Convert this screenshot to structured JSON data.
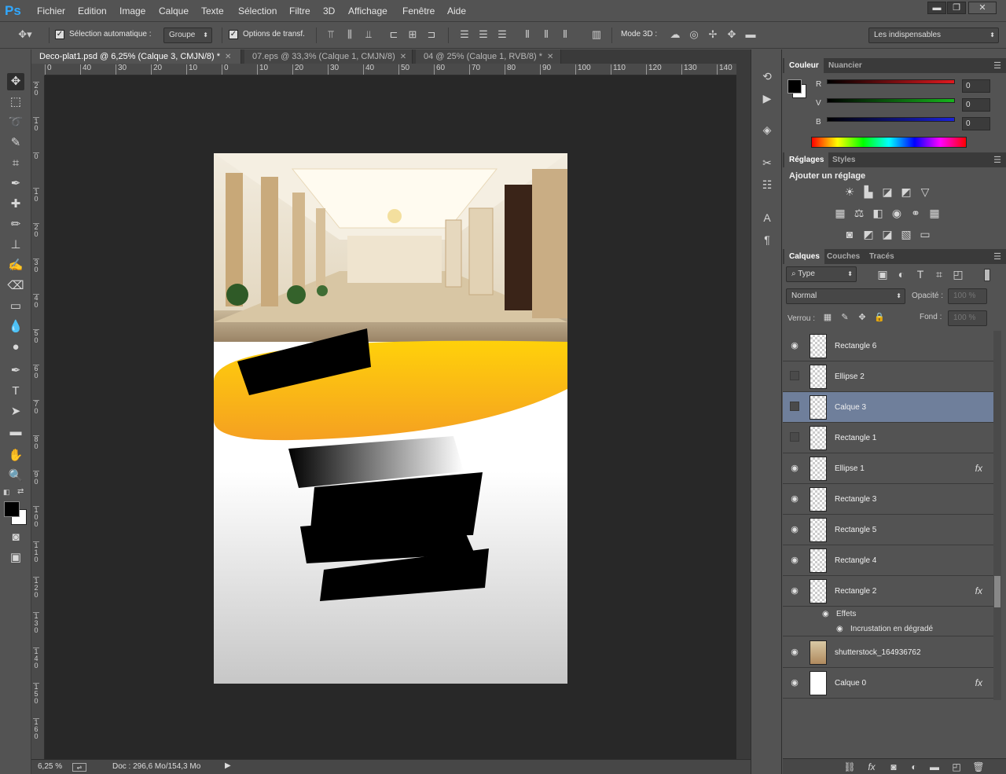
{
  "app": {
    "logo": "Ps"
  },
  "menu": [
    "Fichier",
    "Edition",
    "Image",
    "Calque",
    "Texte",
    "Sélection",
    "Filtre",
    "3D",
    "Affichage",
    "Fenêtre",
    "Aide"
  ],
  "window_controls": {
    "minimize": "▬",
    "restore": "❐",
    "close": "✕"
  },
  "options_bar": {
    "auto_select_label": "Sélection automatique :",
    "auto_select_value": "Groupe",
    "transform_label": "Options de transf.",
    "mode3d_label": "Mode 3D :",
    "workspace": "Les indispensables"
  },
  "doc_tabs": [
    {
      "label": "Deco-plat1.psd @ 6,25% (Calque 3, CMJN/8) *",
      "active": true
    },
    {
      "label": "07.eps @ 33,3% (Calque 1, CMJN/8)",
      "active": false
    },
    {
      "label": "04 @ 25% (Calque 1, RVB/8) *",
      "active": false
    }
  ],
  "rulers": {
    "h": [
      "0",
      "40",
      "30",
      "20",
      "10",
      "0",
      "10",
      "20",
      "30",
      "40",
      "50",
      "60",
      "70",
      "80",
      "90",
      "100",
      "110",
      "120",
      "130",
      "140"
    ],
    "v": [
      "2\n0",
      "1\n0",
      "0",
      "1\n0",
      "2\n0",
      "3\n0",
      "4\n0",
      "5\n0",
      "6\n0",
      "7\n0",
      "8\n0",
      "9\n0",
      "1\n0\n0",
      "1\n1\n0",
      "1\n2\n0",
      "1\n3\n0",
      "1\n4\n0",
      "1\n5\n0",
      "1\n6\n0"
    ]
  },
  "status": {
    "zoom": "6,25 %",
    "doc": "Doc : 296,6 Mo/154,3 Mo"
  },
  "color_panel": {
    "tabs": [
      "Couleur",
      "Nuancier"
    ],
    "channels": [
      {
        "label": "R",
        "value": "0",
        "color": "#e0191f"
      },
      {
        "label": "V",
        "value": "0",
        "color": "#16b51c"
      },
      {
        "label": "B",
        "value": "0",
        "color": "#1b22d8"
      }
    ]
  },
  "adjustments_panel": {
    "tabs": [
      "Réglages",
      "Styles"
    ],
    "title": "Ajouter un réglage"
  },
  "layers_panel": {
    "tabs": [
      "Calques",
      "Couches",
      "Tracés"
    ],
    "filter": "Type",
    "blend_mode": "Normal",
    "opacity_label": "Opacité :",
    "opacity_value": "100 %",
    "lock_label": "Verrou :",
    "fill_label": "Fond :",
    "fill_value": "100 %",
    "layers": [
      {
        "name": "Rectangle 6",
        "visible": true,
        "fx": false,
        "thumb": "shape"
      },
      {
        "name": "Ellipse 2",
        "visible": false,
        "fx": false,
        "thumb": "shape"
      },
      {
        "name": "Calque 3",
        "visible": false,
        "fx": false,
        "thumb": "empty",
        "selected": true
      },
      {
        "name": "Rectangle 1",
        "visible": false,
        "fx": false,
        "thumb": "shape"
      },
      {
        "name": "Ellipse 1",
        "visible": true,
        "fx": true,
        "thumb": "shape"
      },
      {
        "name": "Rectangle 3",
        "visible": true,
        "fx": false,
        "thumb": "shape"
      },
      {
        "name": "Rectangle 5",
        "visible": true,
        "fx": false,
        "thumb": "shape"
      },
      {
        "name": "Rectangle 4",
        "visible": true,
        "fx": false,
        "thumb": "shape"
      },
      {
        "name": "Rectangle 2",
        "visible": true,
        "fx": true,
        "thumb": "shape"
      },
      {
        "name": "shutterstock_164936762",
        "visible": true,
        "fx": false,
        "thumb": "photo"
      },
      {
        "name": "Calque 0",
        "visible": true,
        "fx": true,
        "thumb": "white"
      }
    ],
    "effects_label": "Effets",
    "effect_name": "Incrustation en dégradé"
  }
}
